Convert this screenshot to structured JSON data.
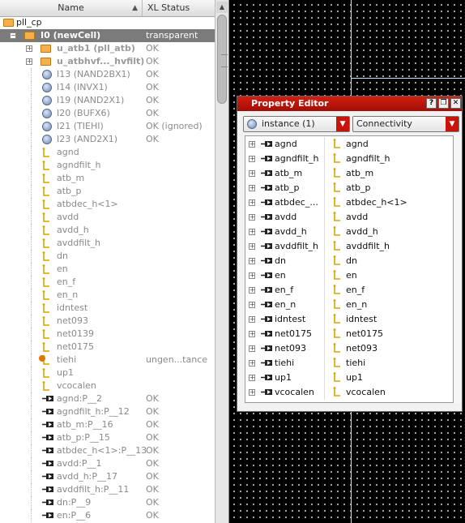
{
  "hierarchy": {
    "col_name": "Name",
    "col_status": "XL Status",
    "rows": [
      {
        "kind": "root",
        "name": "pll_cp",
        "status": ""
      },
      {
        "kind": "cell",
        "name": "I0 (newCell)",
        "status": "transparent",
        "selected": true
      },
      {
        "kind": "cellsub",
        "name": "u_atb1 (pll_atb)",
        "status": "OK"
      },
      {
        "kind": "cellsub",
        "name": "u_atbhvf..._hvfilt)",
        "status": "OK"
      },
      {
        "kind": "inst",
        "name": "I13 (NAND2BX1)",
        "status": "OK"
      },
      {
        "kind": "inst",
        "name": "I14 (INVX1)",
        "status": "OK"
      },
      {
        "kind": "inst",
        "name": "I19 (NAND2X1)",
        "status": "OK"
      },
      {
        "kind": "inst",
        "name": "I20 (BUFX6)",
        "status": "OK"
      },
      {
        "kind": "inst",
        "name": "I21 (TIEHI)",
        "status": "OK (ignored)"
      },
      {
        "kind": "inst",
        "name": "I23 (AND2X1)",
        "status": "OK"
      },
      {
        "kind": "net",
        "name": "agnd",
        "status": ""
      },
      {
        "kind": "net",
        "name": "agndfilt_h",
        "status": ""
      },
      {
        "kind": "net",
        "name": "atb_m",
        "status": ""
      },
      {
        "kind": "net",
        "name": "atb_p",
        "status": ""
      },
      {
        "kind": "net",
        "name": "atbdec_h<1>",
        "status": ""
      },
      {
        "kind": "net",
        "name": "avdd",
        "status": ""
      },
      {
        "kind": "net",
        "name": "avdd_h",
        "status": ""
      },
      {
        "kind": "net",
        "name": "avddfilt_h",
        "status": ""
      },
      {
        "kind": "net",
        "name": "dn",
        "status": ""
      },
      {
        "kind": "net",
        "name": "en",
        "status": ""
      },
      {
        "kind": "net",
        "name": "en_f",
        "status": ""
      },
      {
        "kind": "net",
        "name": "en_n",
        "status": ""
      },
      {
        "kind": "net",
        "name": "idntest",
        "status": ""
      },
      {
        "kind": "net",
        "name": "net093",
        "status": ""
      },
      {
        "kind": "net",
        "name": "net0139",
        "status": ""
      },
      {
        "kind": "net",
        "name": "net0175",
        "status": ""
      },
      {
        "kind": "netwarn",
        "name": "tiehi",
        "status": "ungen...tance"
      },
      {
        "kind": "net",
        "name": "up1",
        "status": ""
      },
      {
        "kind": "net",
        "name": "vcocalen",
        "status": ""
      },
      {
        "kind": "term",
        "name": "agnd:P__2",
        "status": "OK"
      },
      {
        "kind": "term",
        "name": "agndfilt_h:P__12",
        "status": "OK"
      },
      {
        "kind": "term",
        "name": "atb_m:P__16",
        "status": "OK"
      },
      {
        "kind": "term",
        "name": "atb_p:P__15",
        "status": "OK"
      },
      {
        "kind": "term",
        "name": "atbdec_h<1>:P__13",
        "status": "OK"
      },
      {
        "kind": "term",
        "name": "avdd:P__1",
        "status": "OK"
      },
      {
        "kind": "term",
        "name": "avdd_h:P__17",
        "status": "OK"
      },
      {
        "kind": "term",
        "name": "avddfilt_h:P__11",
        "status": "OK"
      },
      {
        "kind": "term",
        "name": "dn:P__9",
        "status": "OK"
      },
      {
        "kind": "term",
        "name": "en:P__6",
        "status": "OK"
      }
    ]
  },
  "property_editor": {
    "title": "Property Editor",
    "help_label": "?",
    "restore_label": "❐",
    "close_label": "✕",
    "object_combo": "instance (1)",
    "view_combo": "Connectivity",
    "rows": [
      {
        "term": "agnd",
        "net": "agnd"
      },
      {
        "term": "agndfilt_h",
        "net": "agndfilt_h"
      },
      {
        "term": "atb_m",
        "net": "atb_m"
      },
      {
        "term": "atb_p",
        "net": "atb_p"
      },
      {
        "term": "atbdec_...",
        "net": "atbdec_h<1>"
      },
      {
        "term": "avdd",
        "net": "avdd"
      },
      {
        "term": "avdd_h",
        "net": "avdd_h"
      },
      {
        "term": "avddfilt_h",
        "net": "avddfilt_h"
      },
      {
        "term": "dn",
        "net": "dn"
      },
      {
        "term": "en",
        "net": "en"
      },
      {
        "term": "en_f",
        "net": "en_f"
      },
      {
        "term": "en_n",
        "net": "en_n"
      },
      {
        "term": "idntest",
        "net": "idntest"
      },
      {
        "term": "net0175",
        "net": "net0175"
      },
      {
        "term": "net093",
        "net": "net093"
      },
      {
        "term": "tiehi",
        "net": "tiehi"
      },
      {
        "term": "up1",
        "net": "up1"
      },
      {
        "term": "vcocalen",
        "net": "vcocalen"
      }
    ]
  },
  "colors": {
    "title_bar": "#c0170b",
    "selection": "#7b7b7b",
    "canvas": "#000000",
    "canvas_line": "#bfe6ff"
  },
  "icons": {
    "folder": "folder-icon",
    "instance": "instance-icon",
    "net": "net-icon",
    "terminal": "terminal-icon",
    "warning": "warning-net-icon"
  }
}
